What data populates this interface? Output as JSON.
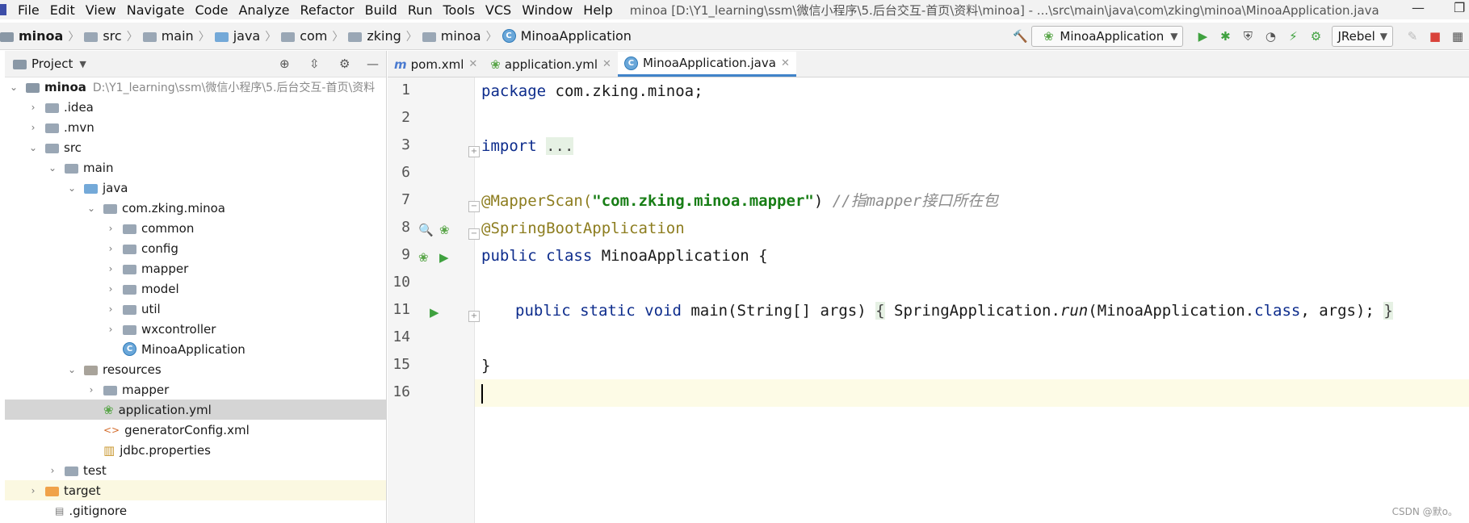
{
  "menu": {
    "items": [
      "File",
      "Edit",
      "View",
      "Navigate",
      "Code",
      "Analyze",
      "Refactor",
      "Build",
      "Run",
      "Tools",
      "VCS",
      "Window",
      "Help"
    ],
    "window_title": "minoa [D:\\Y1_learning\\ssm\\微信小程序\\5.后台交互-首页\\资料\\minoa] - ...\\src\\main\\java\\com\\zking\\minoa\\MinoaApplication.java"
  },
  "breadcrumb": [
    "minoa",
    "src",
    "main",
    "java",
    "com",
    "zking",
    "minoa",
    "MinoaApplication"
  ],
  "toolbar": {
    "run_config": "MinoaApplication",
    "jrebel": "JRebel"
  },
  "project": {
    "title": "Project",
    "root_name": "minoa",
    "root_path": "D:\\Y1_learning\\ssm\\微信小程序\\5.后台交互-首页\\资料",
    "tree": [
      {
        "label": ".idea"
      },
      {
        "label": ".mvn"
      },
      {
        "label": "src"
      },
      {
        "label": "main"
      },
      {
        "label": "java"
      },
      {
        "label": "com.zking.minoa"
      },
      {
        "label": "common"
      },
      {
        "label": "config"
      },
      {
        "label": "mapper"
      },
      {
        "label": "model"
      },
      {
        "label": "util"
      },
      {
        "label": "wxcontroller"
      },
      {
        "label": "MinoaApplication"
      },
      {
        "label": "resources"
      },
      {
        "label": "mapper"
      },
      {
        "label": "application.yml"
      },
      {
        "label": "generatorConfig.xml"
      },
      {
        "label": "jdbc.properties"
      },
      {
        "label": "test"
      },
      {
        "label": "target"
      },
      {
        "label": ".gitignore"
      }
    ]
  },
  "tabs": [
    {
      "label": "pom.xml"
    },
    {
      "label": "application.yml"
    },
    {
      "label": "MinoaApplication.java"
    }
  ],
  "code": {
    "line_numbers": [
      "1",
      "2",
      "3",
      "6",
      "7",
      "8",
      "9",
      "10",
      "11",
      "14",
      "15",
      "16"
    ],
    "package_kw": "package",
    "package_name": " com.zking.minoa;",
    "import_kw": "import",
    "import_fold": "...",
    "mapperscan_ann": "@MapperScan(",
    "mapperscan_str": "\"com.zking.minoa.mapper\"",
    "mapperscan_close": ") ",
    "mapperscan_cmt": "//指mapper接口所在包",
    "springboot_ann": "@SpringBootApplication",
    "class_kw": "public class",
    "class_name": " MinoaApplication {",
    "main_kw": "public static void",
    "main_sig": " main(String[] args) ",
    "brace_open": "{",
    "run_pre": " SpringApplication.",
    "run_method": "run",
    "run_args": "(MinoaApplication.",
    "class_kw2": "class",
    "run_end": ", args); ",
    "brace_close": "}",
    "close_brace": "}"
  },
  "watermark": "CSDN @默o。"
}
